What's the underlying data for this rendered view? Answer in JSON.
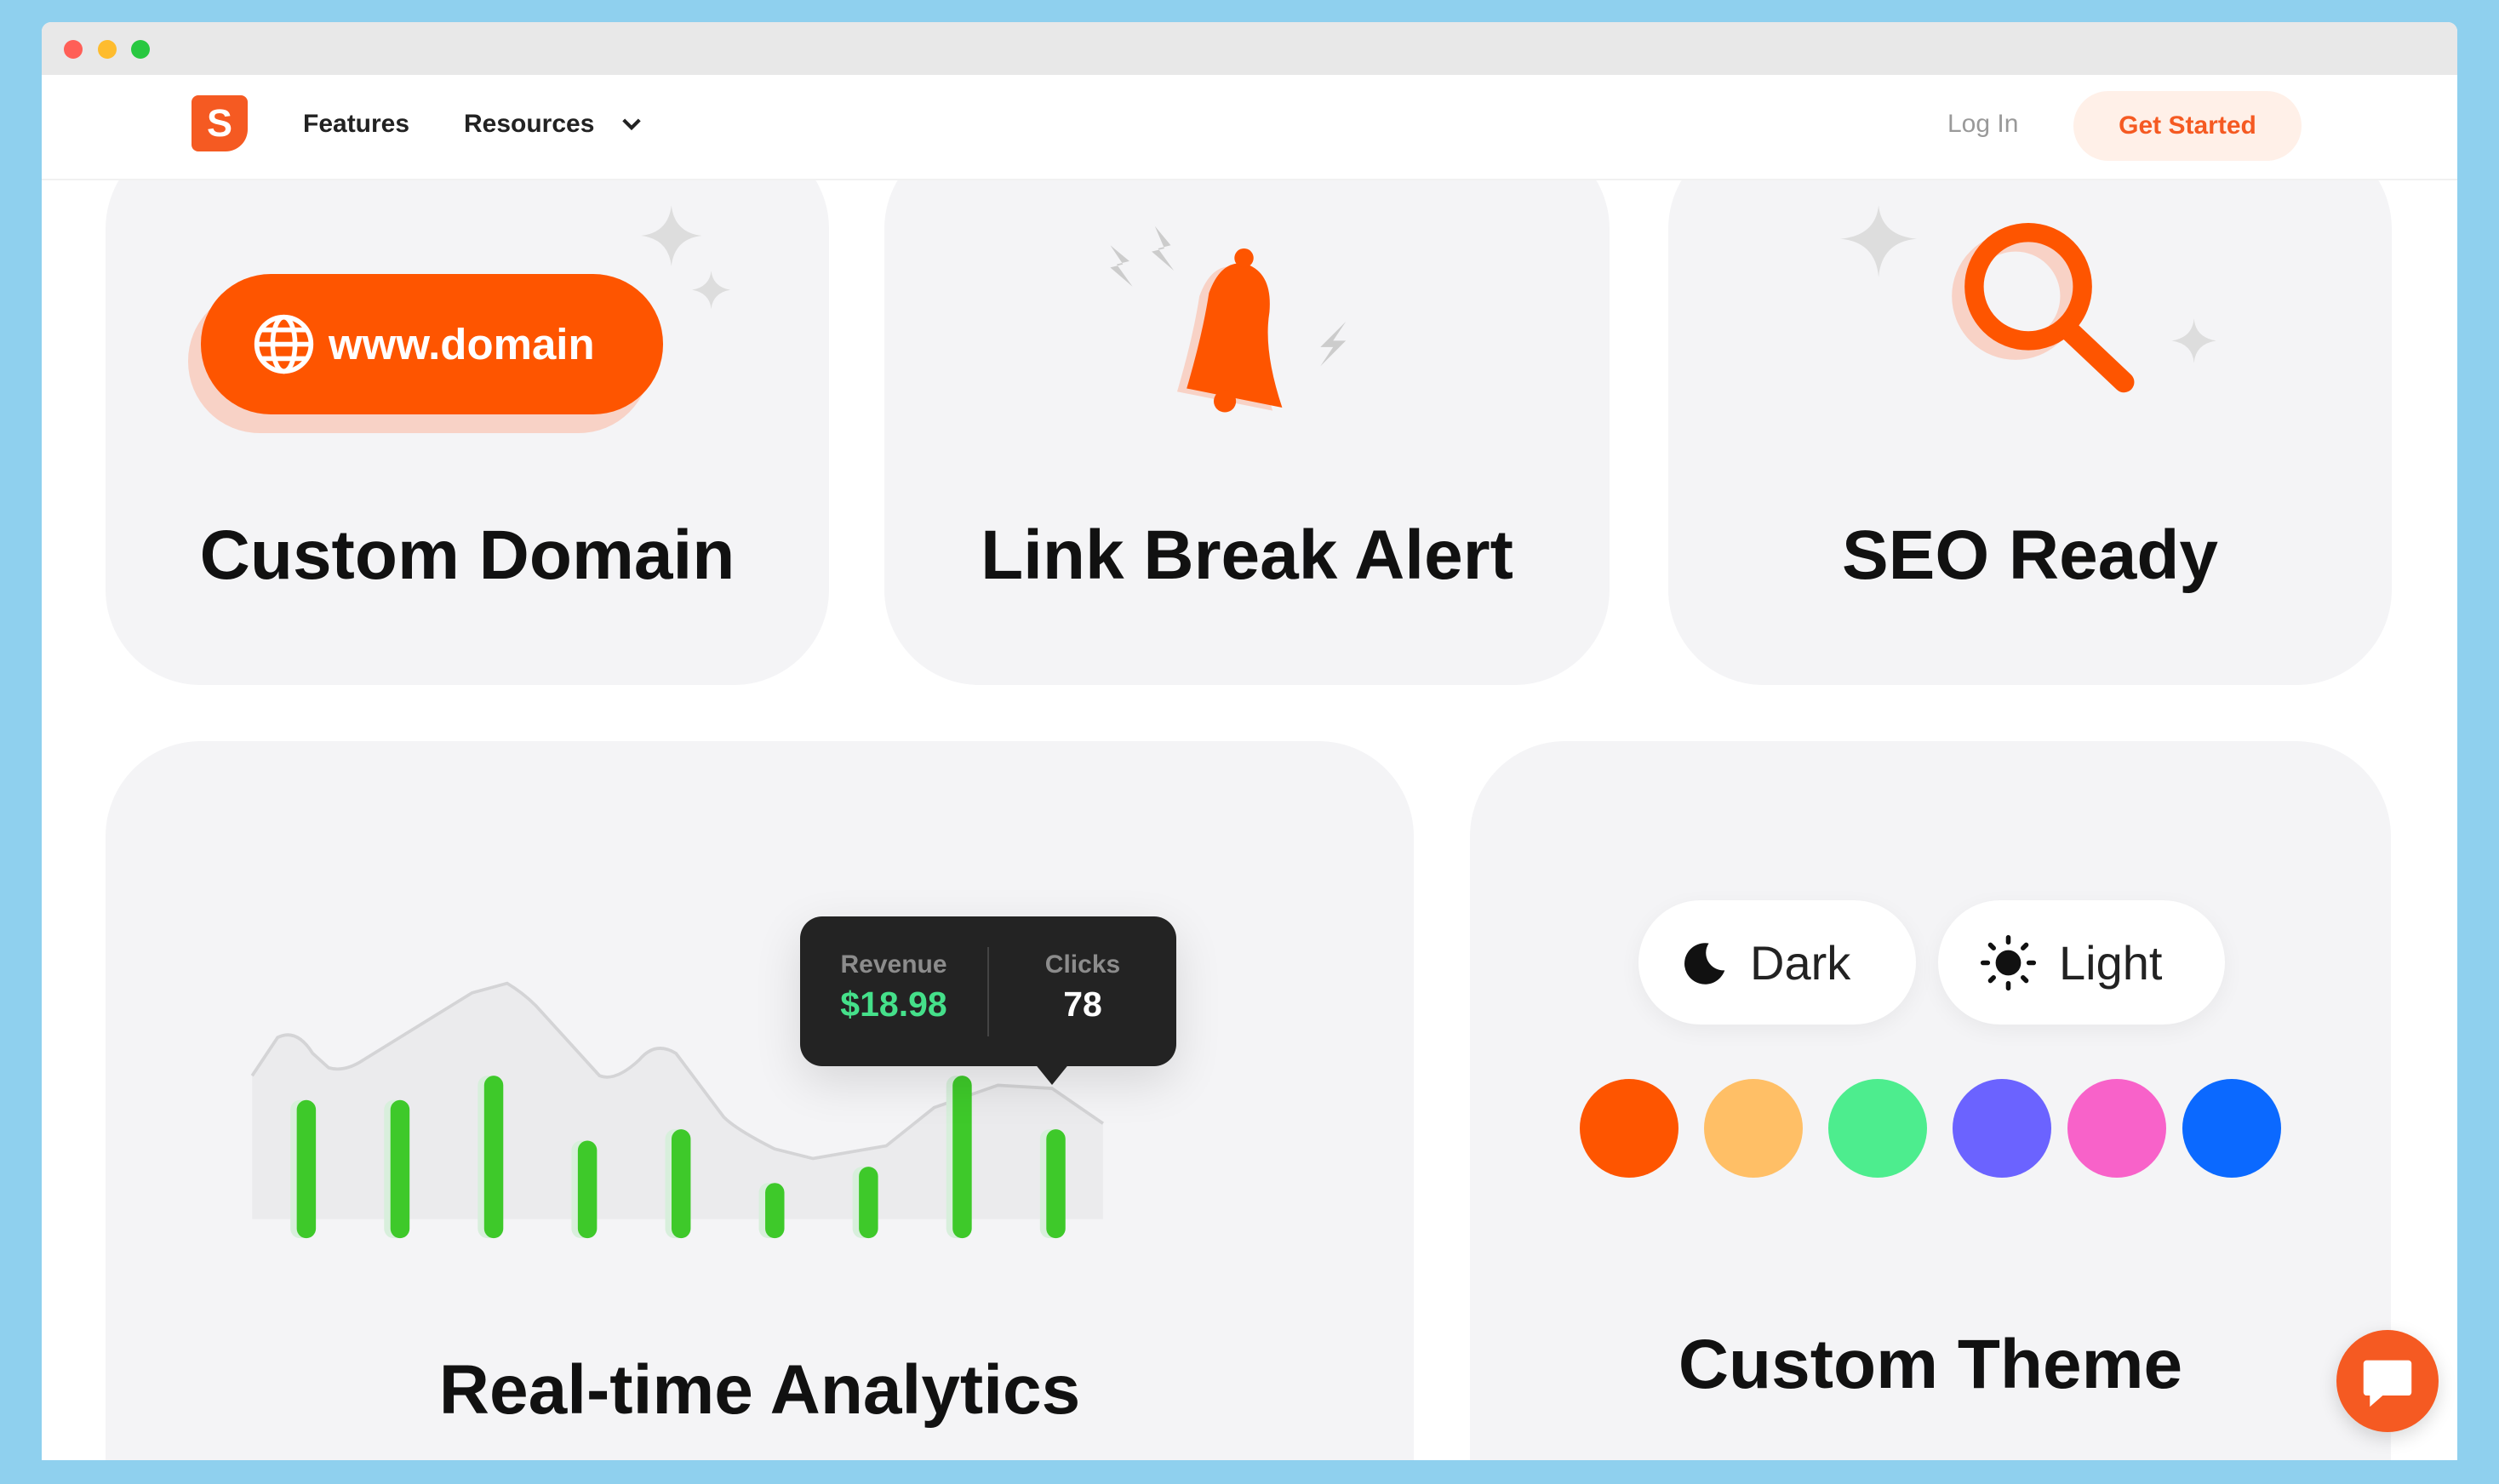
{
  "nav": {
    "logo": "S",
    "features": "Features",
    "resources": "Resources",
    "login": "Log In",
    "get_started": "Get Started"
  },
  "cards": {
    "custom_domain": {
      "title": "Custom Domain",
      "badge": "www.domain"
    },
    "link_break_alert": {
      "title": "Link Break Alert"
    },
    "seo_ready": {
      "title": "SEO Ready"
    },
    "analytics": {
      "title": "Real-time Analytics",
      "tooltip": {
        "revenue_label": "Revenue",
        "revenue_value": "$18.98",
        "clicks_label": "Clicks",
        "clicks_value": "78"
      },
      "bar_levels": [
        0.85,
        0.85,
        1.0,
        0.6,
        0.67,
        0.34,
        0.44,
        1.0,
        0.67
      ]
    },
    "custom_theme": {
      "title": "Custom Theme",
      "dark": "Dark",
      "light": "Light",
      "colors": [
        "#fe5500",
        "#ffbf66",
        "#4ded8e",
        "#6b63ff",
        "#f862c9",
        "#0b69ff"
      ]
    }
  },
  "colors": {
    "brand": "#f55a22",
    "accent_green": "#3ec92a",
    "background": "#8fd0ee"
  }
}
